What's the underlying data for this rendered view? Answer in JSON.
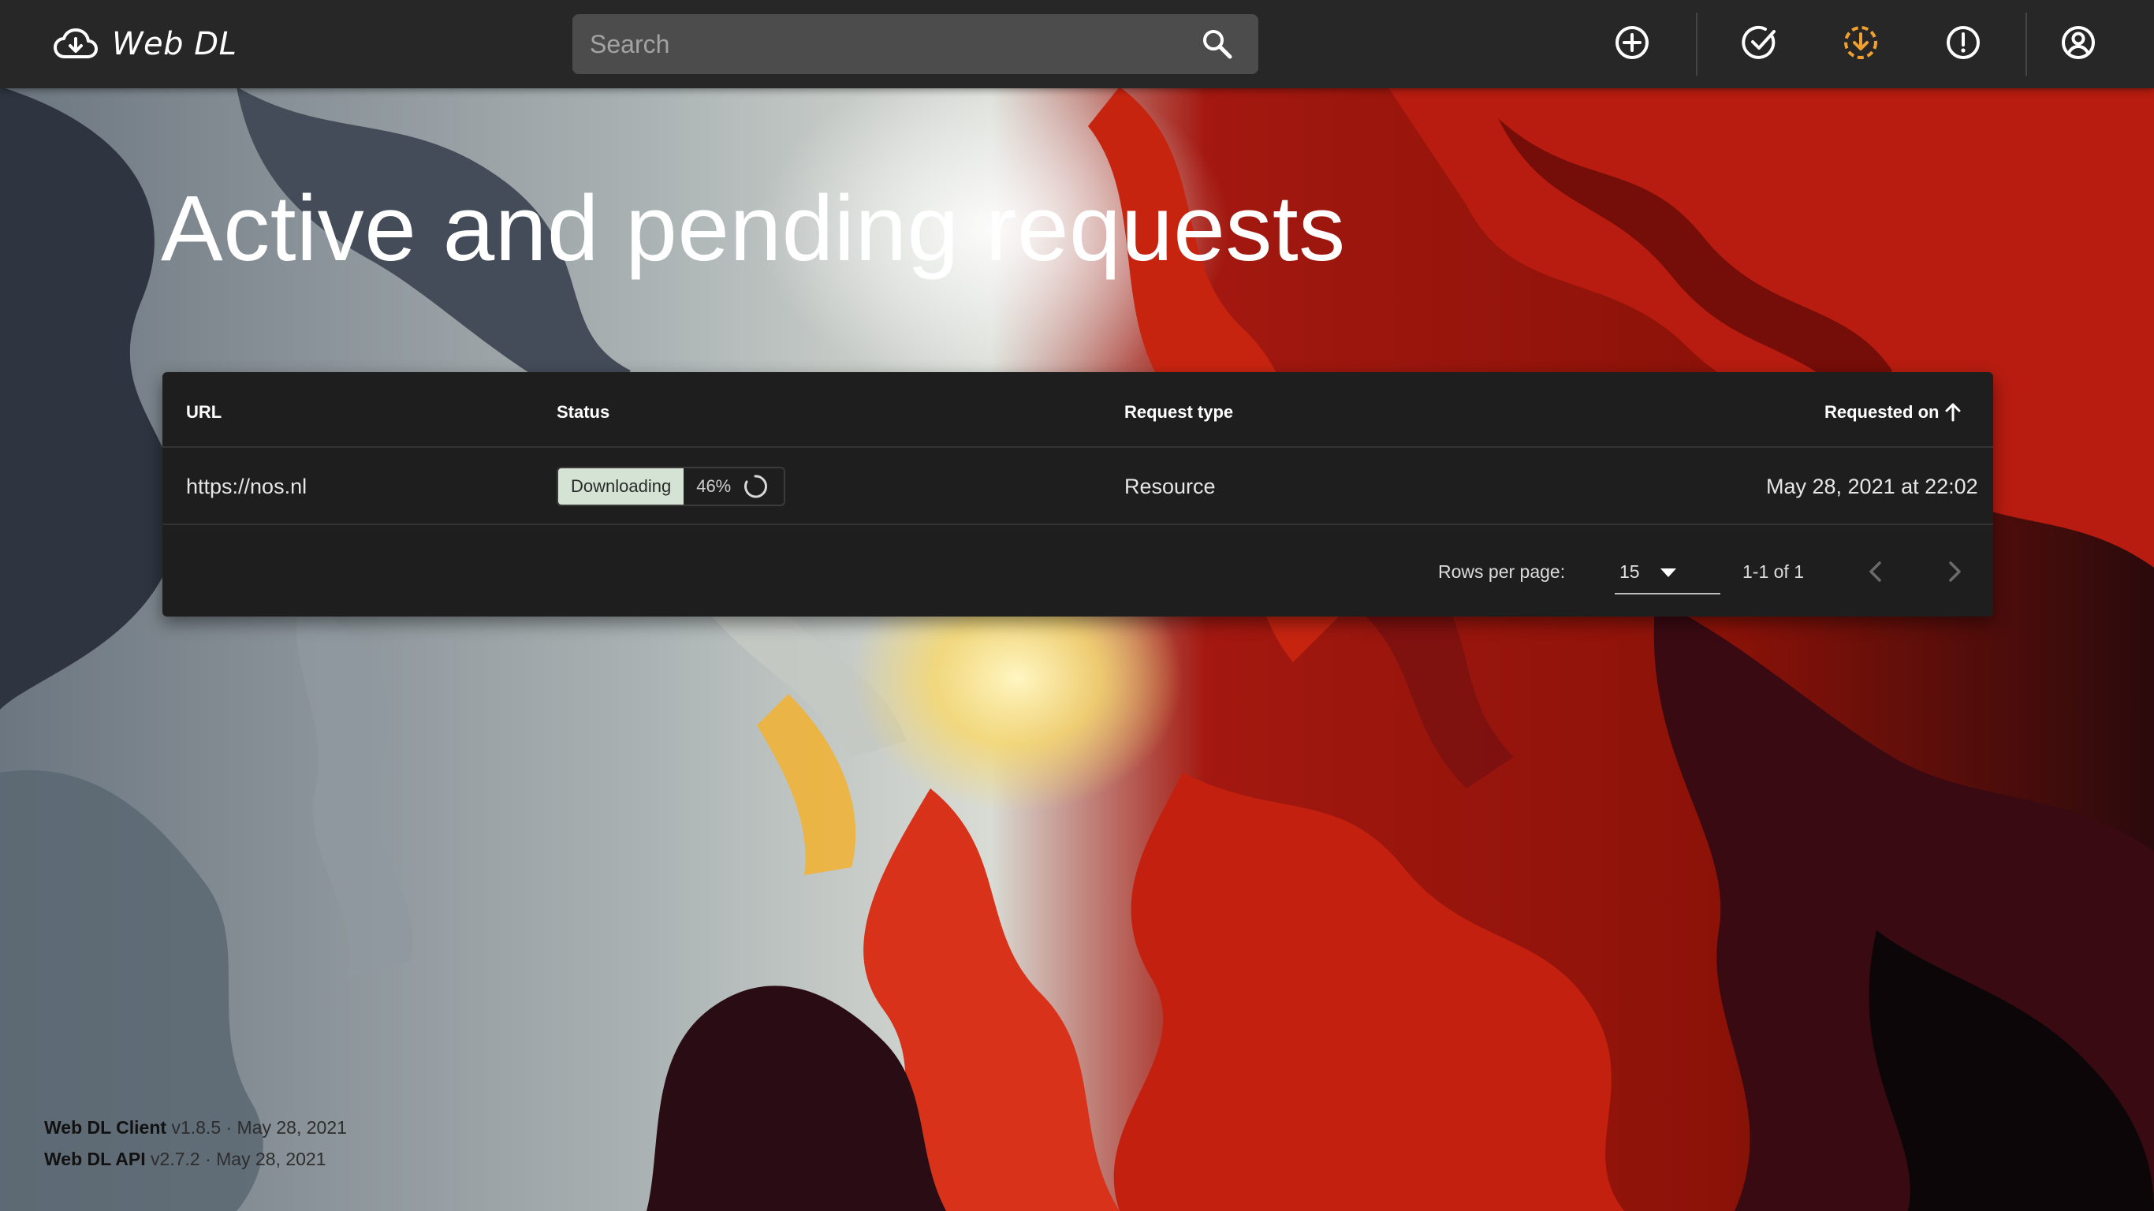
{
  "app": {
    "title": "Web DL",
    "logo_icon": "cloud-download-icon"
  },
  "search": {
    "placeholder": "Search",
    "icon": "search-icon"
  },
  "nav": {
    "items": [
      {
        "name": "add",
        "icon": "add-circle-icon",
        "active": false
      },
      {
        "name": "completed",
        "icon": "check-circle-icon",
        "active": false
      },
      {
        "name": "active",
        "icon": "download-progress-icon",
        "active": true
      },
      {
        "name": "failed",
        "icon": "alert-circle-icon",
        "active": false
      },
      {
        "name": "account",
        "icon": "account-circle-icon",
        "active": false
      }
    ],
    "active_color": "#f0a030"
  },
  "page": {
    "title": "Active and pending requests"
  },
  "table": {
    "headers": {
      "url": "URL",
      "status": "Status",
      "request_type": "Request type",
      "requested_on": "Requested on"
    },
    "sort": {
      "column": "requested_on",
      "direction": "ascending",
      "icon": "arrow-up-icon"
    },
    "rows": [
      {
        "url": "https://nos.nl",
        "status": "Downloading",
        "progress": "46%",
        "progress_value": 46,
        "request_type": "Resource",
        "requested_on": "May 28, 2021 at 22:02"
      }
    ],
    "pagination": {
      "rows_per_page_label": "Rows per page:",
      "rows_per_page": "15",
      "range": "1-1 of 1",
      "prev_icon": "chevron-left-icon",
      "next_icon": "chevron-right-icon"
    }
  },
  "footer": {
    "client": {
      "name": "Web DL Client",
      "meta": "v1.8.5 · May 28, 2021"
    },
    "api": {
      "name": "Web DL API",
      "meta": "v2.7.2 · May 28, 2021"
    }
  },
  "colors": {
    "appbar": "#272727",
    "card": "#1e1e1e",
    "status_chip": "#d4e3d4",
    "accent": "#f0a030"
  }
}
